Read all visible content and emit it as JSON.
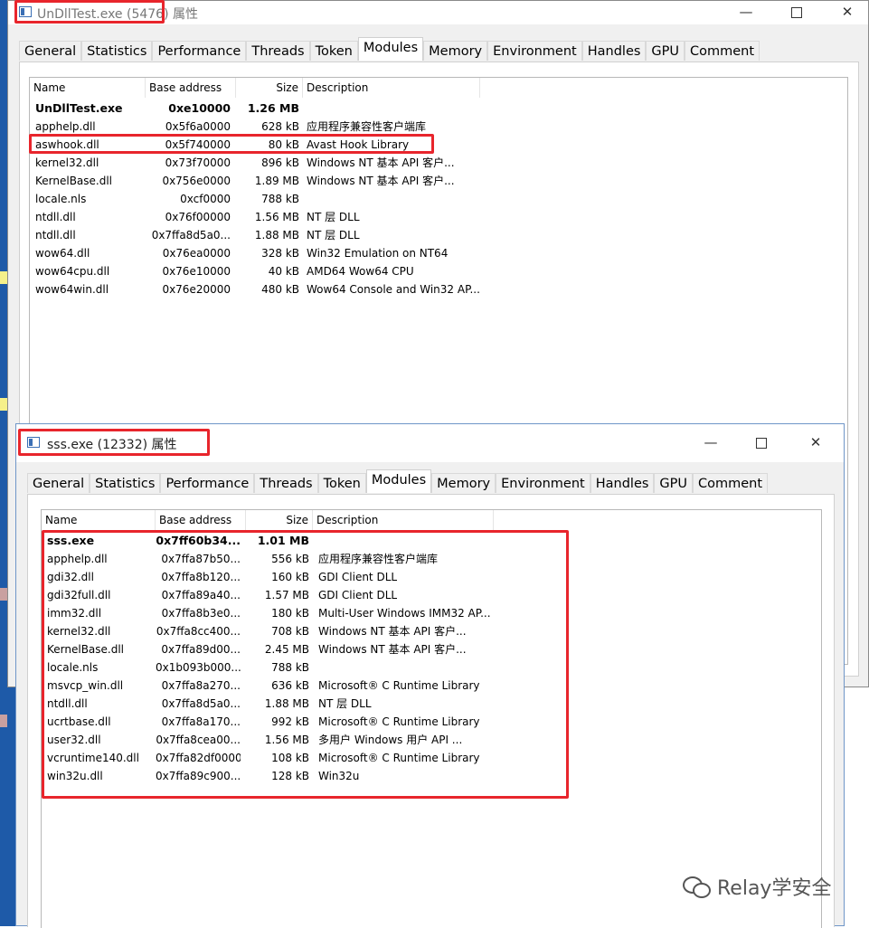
{
  "window1": {
    "title": "UnDllTest.exe (5476) 属性",
    "tabs": [
      "General",
      "Statistics",
      "Performance",
      "Threads",
      "Token",
      "Modules",
      "Memory",
      "Environment",
      "Handles",
      "GPU",
      "Comment"
    ],
    "active_tab": "Modules",
    "columns": [
      "Name",
      "Base address",
      "Size",
      "Description"
    ],
    "rows": [
      {
        "name": "UnDllTest.exe",
        "base": "0xe10000",
        "size": "1.26 MB",
        "desc": ""
      },
      {
        "name": "apphelp.dll",
        "base": "0x5f6a0000",
        "size": "628 kB",
        "desc": "应用程序兼容性客户端库"
      },
      {
        "name": "aswhook.dll",
        "base": "0x5f740000",
        "size": "80 kB",
        "desc": "Avast Hook Library"
      },
      {
        "name": "kernel32.dll",
        "base": "0x73f70000",
        "size": "896 kB",
        "desc": "Windows NT 基本 API 客户..."
      },
      {
        "name": "KernelBase.dll",
        "base": "0x756e0000",
        "size": "1.89 MB",
        "desc": "Windows NT 基本 API 客户..."
      },
      {
        "name": "locale.nls",
        "base": "0xcf0000",
        "size": "788 kB",
        "desc": ""
      },
      {
        "name": "ntdll.dll",
        "base": "0x76f00000",
        "size": "1.56 MB",
        "desc": "NT 层 DLL"
      },
      {
        "name": "ntdll.dll",
        "base": "0x7ffa8d5a0...",
        "size": "1.88 MB",
        "desc": "NT 层 DLL"
      },
      {
        "name": "wow64.dll",
        "base": "0x76ea0000",
        "size": "328 kB",
        "desc": "Win32 Emulation on NT64"
      },
      {
        "name": "wow64cpu.dll",
        "base": "0x76e10000",
        "size": "40 kB",
        "desc": "AMD64 Wow64 CPU"
      },
      {
        "name": "wow64win.dll",
        "base": "0x76e20000",
        "size": "480 kB",
        "desc": "Wow64 Console and Win32 AP..."
      }
    ]
  },
  "window2": {
    "title": "sss.exe (12332) 属性",
    "tabs": [
      "General",
      "Statistics",
      "Performance",
      "Threads",
      "Token",
      "Modules",
      "Memory",
      "Environment",
      "Handles",
      "GPU",
      "Comment"
    ],
    "active_tab": "Modules",
    "columns": [
      "Name",
      "Base address",
      "Size",
      "Description"
    ],
    "rows": [
      {
        "name": "sss.exe",
        "base": "0x7ff60b34...",
        "size": "1.01 MB",
        "desc": ""
      },
      {
        "name": "apphelp.dll",
        "base": "0x7ffa87b50...",
        "size": "556 kB",
        "desc": "应用程序兼容性客户端库"
      },
      {
        "name": "gdi32.dll",
        "base": "0x7ffa8b120...",
        "size": "160 kB",
        "desc": "GDI Client DLL"
      },
      {
        "name": "gdi32full.dll",
        "base": "0x7ffa89a40...",
        "size": "1.57 MB",
        "desc": "GDI Client DLL"
      },
      {
        "name": "imm32.dll",
        "base": "0x7ffa8b3e0...",
        "size": "180 kB",
        "desc": "Multi-User Windows IMM32 AP..."
      },
      {
        "name": "kernel32.dll",
        "base": "0x7ffa8cc400...",
        "size": "708 kB",
        "desc": "Windows NT 基本 API 客户..."
      },
      {
        "name": "KernelBase.dll",
        "base": "0x7ffa89d00...",
        "size": "2.45 MB",
        "desc": "Windows NT 基本 API 客户..."
      },
      {
        "name": "locale.nls",
        "base": "0x1b093b000...",
        "size": "788 kB",
        "desc": ""
      },
      {
        "name": "msvcp_win.dll",
        "base": "0x7ffa8a270...",
        "size": "636 kB",
        "desc": "Microsoft® C Runtime Library"
      },
      {
        "name": "ntdll.dll",
        "base": "0x7ffa8d5a0...",
        "size": "1.88 MB",
        "desc": "NT 层 DLL"
      },
      {
        "name": "ucrtbase.dll",
        "base": "0x7ffa8a170...",
        "size": "992 kB",
        "desc": "Microsoft® C Runtime Library"
      },
      {
        "name": "user32.dll",
        "base": "0x7ffa8cea00...",
        "size": "1.56 MB",
        "desc": "多用户 Windows 用户 API ..."
      },
      {
        "name": "vcruntime140.dll",
        "base": "0x7ffa82df0000",
        "size": "108 kB",
        "desc": "Microsoft® C Runtime Library"
      },
      {
        "name": "win32u.dll",
        "base": "0x7ffa89c900...",
        "size": "128 kB",
        "desc": "Win32u"
      }
    ]
  },
  "controls": {
    "minimize": "—",
    "close": "✕"
  },
  "watermark": "Relay学安全",
  "colors": {
    "highlight": "#e8252c",
    "desktop": "#1e5aa8"
  }
}
